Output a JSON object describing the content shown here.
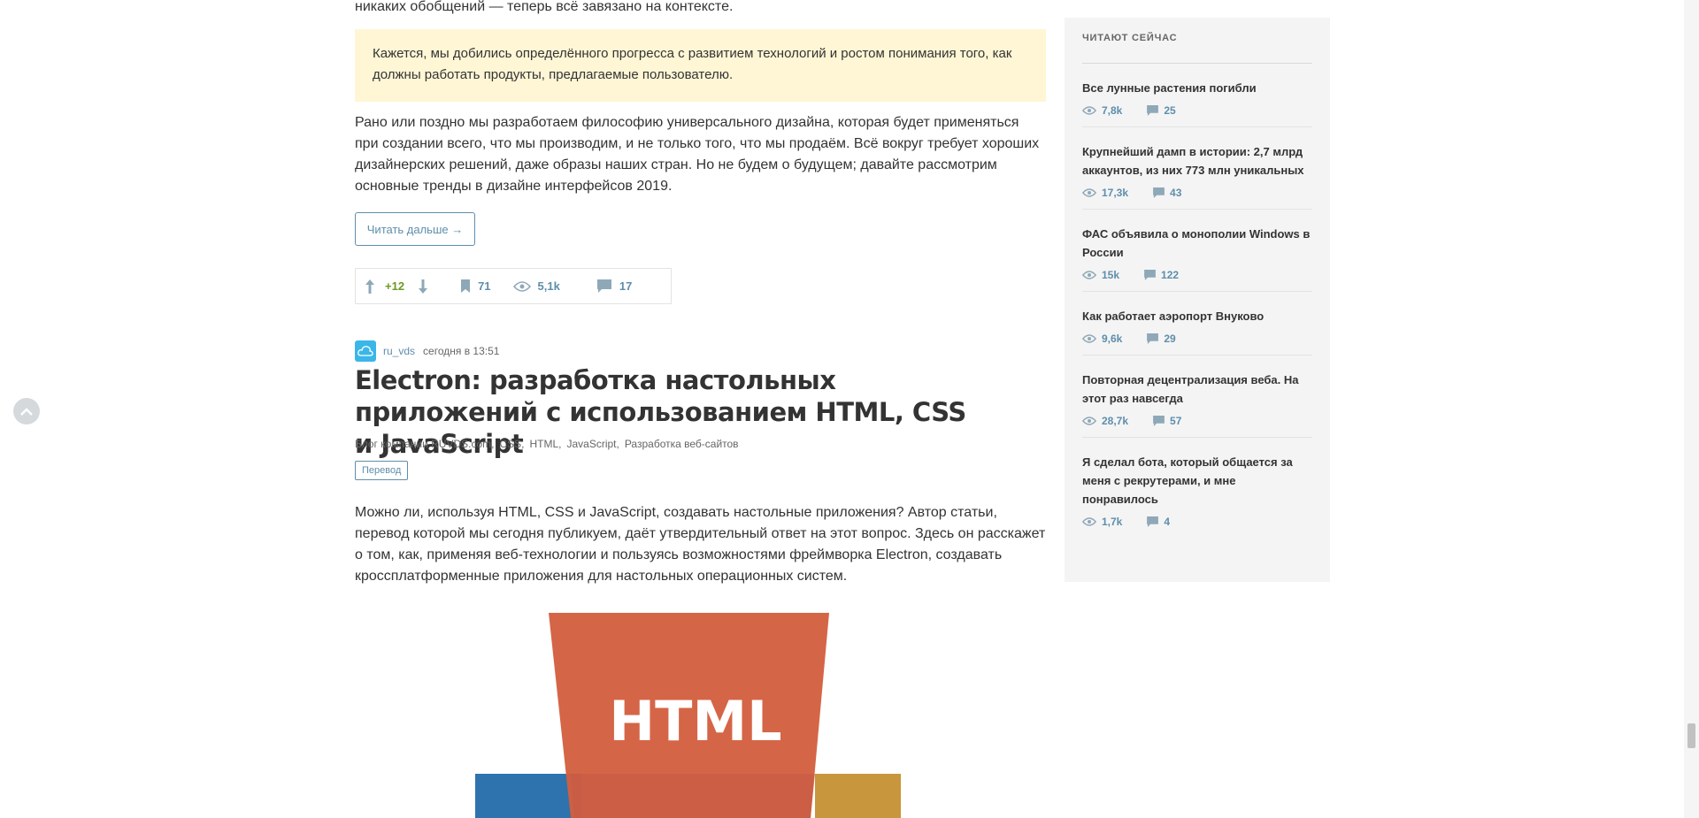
{
  "article1": {
    "top_text": "никаких обобщений — теперь всё завязано на контексте.",
    "quote": "Кажется, мы добились определённого прогресса с развитием технологий и ростом понимания того, как должны работать продукты, предлагаемые пользователю.",
    "paragraph": "Рано или поздно мы разработаем философию универсального дизайна, которая будет применяться при создании всего, что мы производим, и не только того, что мы продаём. Всё вокруг требует хороших дизайнерских решений, даже образы наших стран. Но не будем о будущем; давайте рассмотрим основные тренды в дизайне интерфейсов 2019.",
    "read_more": "Читать дальше →",
    "score": "+12",
    "bookmarks": "71",
    "views": "5,1k",
    "comments": "17"
  },
  "article2": {
    "logo_text": "ru",
    "author": "ru_vds",
    "time": "сегодня в 13:51",
    "title": "Electron: разработка настольных приложений с использованием HTML, CSS и JavaScript",
    "hubs": [
      "Блог компании RUVDS.com,",
      "CSS,",
      "HTML,",
      "JavaScript,",
      "Разработка веб-сайтов"
    ],
    "badge": "Перевод",
    "paragraph": "Можно ли, используя HTML, CSS и JavaScript, создавать настольные приложения? Автор статьи, перевод которой мы сегодня публикуем, даёт утвердительный ответ на этот вопрос. Здесь он расскажет о том, как, применяя веб-технологии и пользуясь возможностями фреймворка Electron, создавать кроссплатформенные приложения для настольных операционных систем.",
    "illustration_text": "HTML",
    "colors": {
      "html": "#d35f3f",
      "css": "#2e73ad",
      "js": "#c8963c"
    }
  },
  "sidebar": {
    "title": "ЧИТАЮТ СЕЙЧАС",
    "items": [
      {
        "title": "Все лунные растения погибли",
        "views": "7,8k",
        "comments": "25"
      },
      {
        "title": "Крупнейший дамп в истории: 2,7 млрд аккаунтов, из них 773 млн уникальных",
        "views": "17,3k",
        "comments": "43"
      },
      {
        "title": "ФАС объявила о монополии Windows в России",
        "views": "15k",
        "comments": "122"
      },
      {
        "title": "Как работает аэропорт Внуково",
        "views": "9,6k",
        "comments": "29"
      },
      {
        "title": "Повторная децентрализация веба. На этот раз навсегда",
        "views": "28,7k",
        "comments": "57"
      },
      {
        "title": "Я сделал бота, который общается за меня с рекрутерами, и мне понравилось",
        "views": "1,7k",
        "comments": "4"
      }
    ]
  }
}
